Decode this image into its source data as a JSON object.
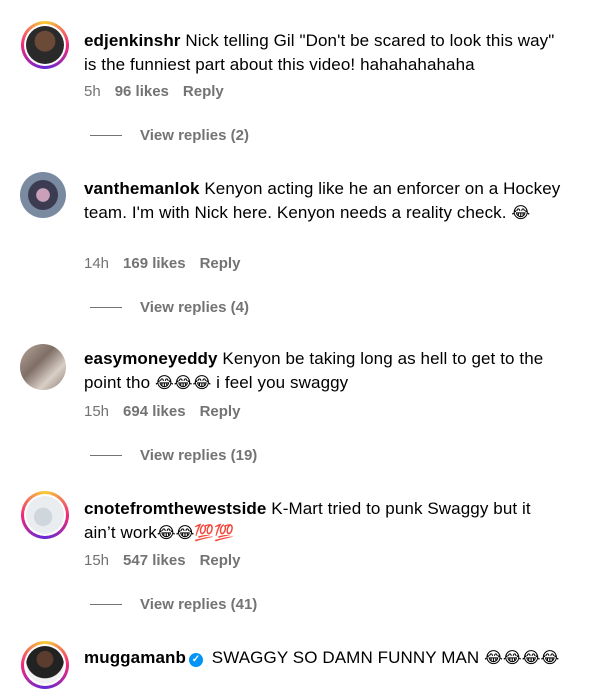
{
  "comments": [
    {
      "username": "edjenkinshr",
      "text": " Nick telling Gil \"Don't be scared to look this way\" is the funniest part about this video! hahahahahaha",
      "time": "5h",
      "likes": "96 likes",
      "reply": "Reply",
      "view_replies": "View replies (2)"
    },
    {
      "username": "vanthemanlok",
      "text": " Kenyon acting like he an enforcer on a Hockey team. I'm with Nick here. Kenyon needs a reality check. ",
      "emoji": "😂",
      "time": "14h",
      "likes": "169 likes",
      "reply": "Reply",
      "view_replies": "View replies (4)"
    },
    {
      "username": "easymoneyeddy",
      "text": " Kenyon be taking long as hell to get to the point tho ",
      "emoji": "😂😂😂",
      "text_after": " i feel you swaggy",
      "time": "15h",
      "likes": "694 likes",
      "reply": "Reply",
      "view_replies": "View replies (19)"
    },
    {
      "username": "cnotefromthewestside",
      "text": " K-Mart tried to punk Swaggy but it ain’t work",
      "emoji": "😂😂💯💯",
      "time": "15h",
      "likes": "547 likes",
      "reply": "Reply",
      "view_replies": "View replies (41)"
    },
    {
      "username": "muggamanb",
      "verified_mark": "✓",
      "text": " SWAGGY SO DAMN FUNNY MAN ",
      "emoji": "😂😂😂😂"
    }
  ],
  "colors": {
    "secondary_text": "#737373",
    "verified": "#0095f6"
  }
}
